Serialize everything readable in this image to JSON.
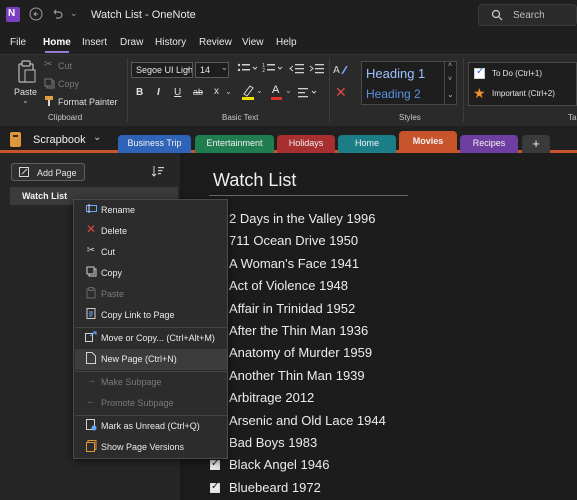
{
  "app": {
    "icon_letter": "N",
    "window_title": "Watch List - OneNote",
    "search_placeholder": "Search"
  },
  "menu": {
    "items": [
      "File",
      "Home",
      "Insert",
      "Draw",
      "History",
      "Review",
      "View",
      "Help"
    ],
    "active": "Home"
  },
  "ribbon": {
    "clipboard": {
      "paste": "Paste",
      "cut": "Cut",
      "copy": "Copy",
      "format_painter": "Format Painter",
      "group_label": "Clipboard"
    },
    "basic_text": {
      "font": "Segoe UI Light",
      "size": "14",
      "bold": "B",
      "italic": "I",
      "underline": "U",
      "strike": "ab",
      "subscript": "x",
      "highlight_letter": "A",
      "group_label": "Basic Text"
    },
    "styles": {
      "heading1": "Heading 1",
      "heading2": "Heading 2",
      "group_label": "Styles"
    },
    "tags": {
      "todo": "To Do (Ctrl+1)",
      "important": "Important (Ctrl+2)",
      "group_label": "Ta"
    }
  },
  "notebook": {
    "name": "Scrapbook",
    "sections": [
      {
        "label": "Business Trip",
        "color": "#2f63b8"
      },
      {
        "label": "Entertainment",
        "color": "#1f7d4f"
      },
      {
        "label": "Holidays",
        "color": "#a72f30"
      },
      {
        "label": "Home",
        "color": "#1b7e86"
      },
      {
        "label": "Movies",
        "color": "#c8542c"
      },
      {
        "label": "Recipes",
        "color": "#6e3fa0"
      }
    ],
    "active_section": "Movies",
    "add_section": "+"
  },
  "pages_pane": {
    "add_page": "Add Page",
    "pages": [
      "Watch List"
    ]
  },
  "page": {
    "title": "Watch List",
    "items": [
      {
        "text": "2 Days in the Valley 1996",
        "checked": false
      },
      {
        "text": "711 Ocean Drive 1950",
        "checked": false
      },
      {
        "text": "A Woman's Face 1941",
        "checked": false
      },
      {
        "text": "Act of Violence 1948",
        "checked": false
      },
      {
        "text": "Affair in Trinidad 1952",
        "checked": false
      },
      {
        "text": "After the Thin Man 1936",
        "checked": false
      },
      {
        "text": "Anatomy of Murder 1959",
        "checked": false
      },
      {
        "text": "Another Thin Man 1939",
        "checked": false
      },
      {
        "text": "Arbitrage 2012",
        "checked": false
      },
      {
        "text": "Arsenic and Old Lace 1944",
        "checked": false
      },
      {
        "text": "Bad Boys 1983",
        "checked": false
      },
      {
        "text": "Black Angel 1946",
        "checked": true
      },
      {
        "text": "Bluebeard 1972",
        "checked": true
      }
    ]
  },
  "context_menu": {
    "items": [
      {
        "label": "Rename",
        "icon": "rename-icon",
        "enabled": true
      },
      {
        "label": "Delete",
        "icon": "delete-icon",
        "enabled": true
      },
      {
        "label": "Cut",
        "icon": "scissors-icon",
        "enabled": true
      },
      {
        "label": "Copy",
        "icon": "copy-icon",
        "enabled": true
      },
      {
        "label": "Paste",
        "icon": "paste-icon",
        "enabled": false
      },
      {
        "label": "Copy Link to Page",
        "icon": "link-icon",
        "enabled": true
      },
      {
        "label": "Move or Copy...  (Ctrl+Alt+M)",
        "icon": "move-icon",
        "enabled": true
      },
      {
        "label": "New Page  (Ctrl+N)",
        "icon": "new-page-icon",
        "enabled": true
      },
      {
        "label": "Make Subpage",
        "icon": "arrow-right-icon",
        "enabled": false
      },
      {
        "label": "Promote Subpage",
        "icon": "arrow-left-icon",
        "enabled": false
      },
      {
        "label": "Mark as Unread  (Ctrl+Q)",
        "icon": "mark-unread-icon",
        "enabled": true
      },
      {
        "label": "Show Page Versions",
        "icon": "versions-icon",
        "enabled": true
      }
    ],
    "highlighted": "New Page  (Ctrl+N)"
  },
  "colors": {
    "accent": "#9b7bd8",
    "onenote_purple": "#7a3fc1",
    "movies_tab": "#c8542c",
    "delete_red": "#e04848",
    "star_orange": "#f0902a",
    "checkbox_blue": "#2a74d6"
  }
}
